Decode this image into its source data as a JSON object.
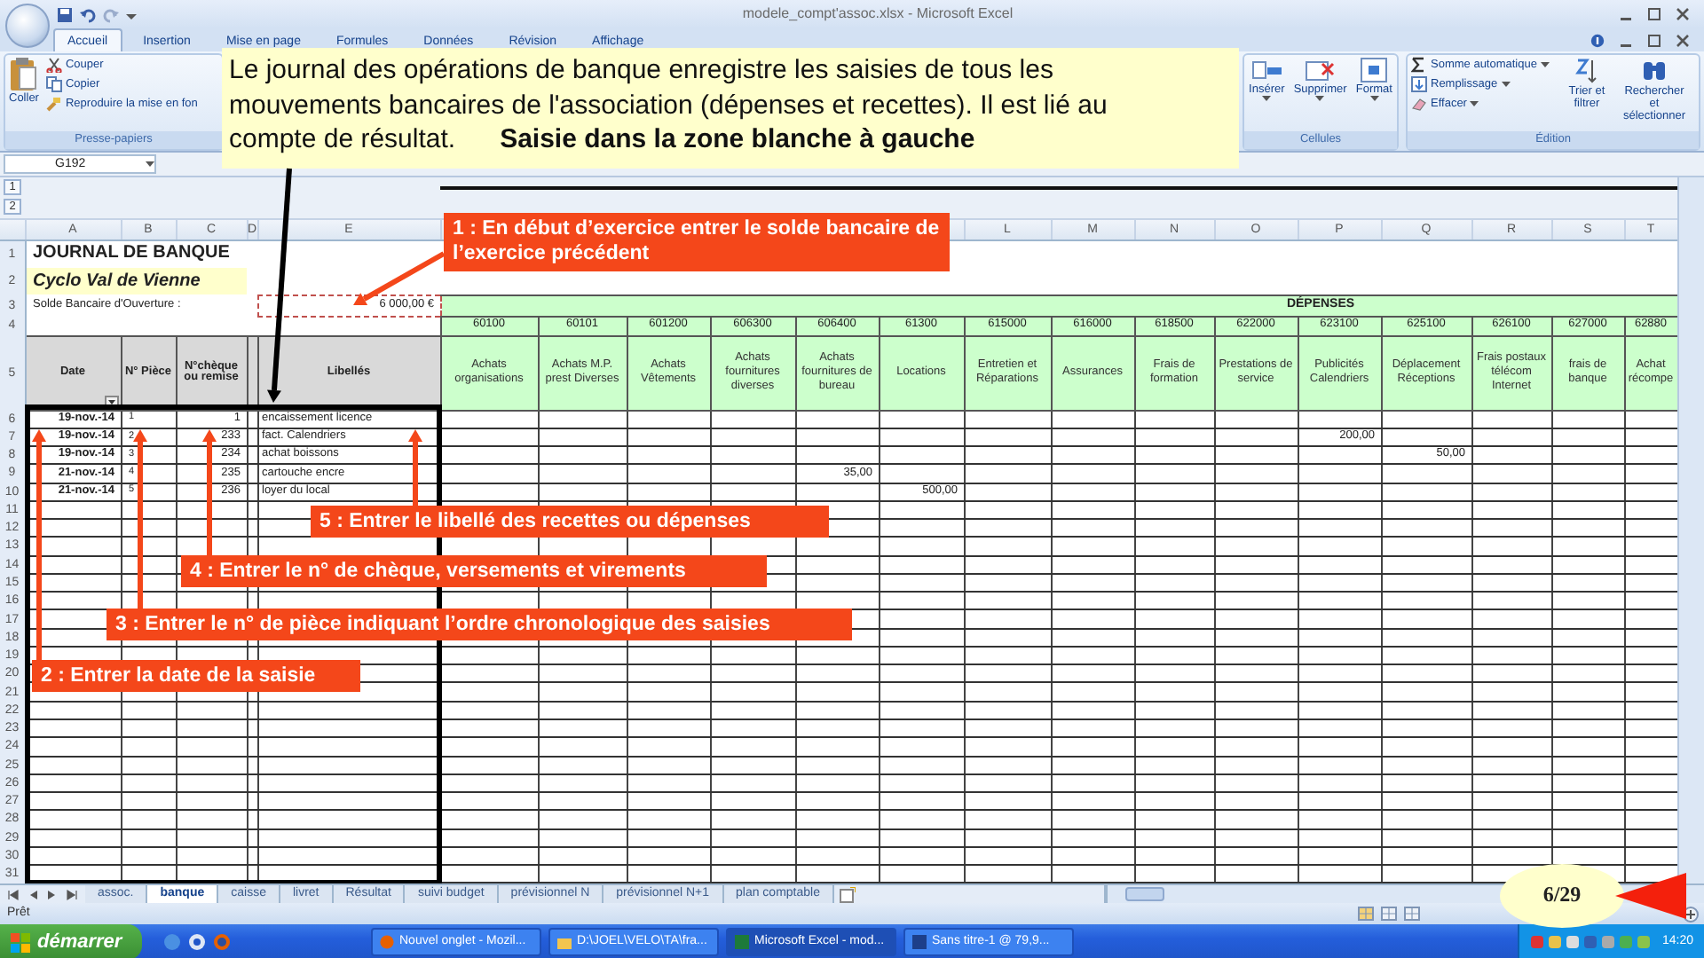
{
  "window": {
    "title": "modele_compt'assoc.xlsx - Microsoft Excel"
  },
  "ribbon": {
    "tabs": [
      {
        "label": "Accueil",
        "selected": true
      },
      {
        "label": "Insertion",
        "selected": false
      },
      {
        "label": "Mise en page",
        "selected": false
      },
      {
        "label": "Formules",
        "selected": false
      },
      {
        "label": "Données",
        "selected": false
      },
      {
        "label": "Révision",
        "selected": false
      },
      {
        "label": "Affichage",
        "selected": false
      }
    ],
    "clipboard": {
      "paste": "Coller",
      "items": [
        "Couper",
        "Copier",
        "Reproduire la mise en fon"
      ],
      "label": "Presse-papiers"
    },
    "cells": {
      "buttons": [
        "Insérer",
        "Supprimer",
        "Format"
      ],
      "label": "Cellules"
    },
    "editing": {
      "items": [
        "Somme automatique",
        "Remplissage",
        "Effacer"
      ],
      "buttons": [
        "Trier et filtrer",
        "Rechercher et sélectionner"
      ],
      "label": "Édition"
    }
  },
  "formula_bar": {
    "name_box": "G192"
  },
  "note": "Le journal des opérations de banque enregistre les saisies de tous les mouvements bancaires de l'association (dépenses et recettes). Il est lié au compte de résultat.      **Saisie dans la zone blanche à gauche**",
  "sheet": {
    "outline_buttons": [
      "1",
      "2"
    ],
    "title": "JOURNAL DE BANQUE",
    "subtitle": "Cyclo Val de Vienne",
    "opening_label": "Solde Bancaire d'Ouverture :",
    "opening_balance": "6 000,00 €",
    "section": "DÉPENSES",
    "left_columns": [
      {
        "letter": "A",
        "header": "Date",
        "filter": true
      },
      {
        "letter": "B",
        "header": "N° Pièce",
        "filter": false
      },
      {
        "letter": "C",
        "header": "N°chèque ou remise",
        "filter": false
      },
      {
        "letter": "D",
        "filter": false
      },
      {
        "letter": "E",
        "header": "Libellés",
        "filter": false
      }
    ],
    "expense_columns": [
      {
        "code": "60100",
        "name": "Achats organisations"
      },
      {
        "code": "60101",
        "name": "Achats M.P. prest Diverses"
      },
      {
        "code": "601200",
        "name": "Achats Vêtements"
      },
      {
        "code": "606300",
        "name": "Achats fournitures diverses"
      },
      {
        "code": "606400",
        "name": "Achats fournitures de bureau"
      },
      {
        "code": "61300",
        "name": "Locations"
      },
      {
        "letter": "L",
        "code": "615000",
        "name": "Entretien et Réparations"
      },
      {
        "letter": "M",
        "code": "616000",
        "name": "Assurances"
      },
      {
        "letter": "N",
        "code": "618500",
        "name": "Frais de formation"
      },
      {
        "letter": "O",
        "code": "622000",
        "name": "Prestations de service"
      },
      {
        "letter": "P",
        "code": "623100",
        "name": "Publicités Calendriers"
      },
      {
        "letter": "Q",
        "code": "625100",
        "name": "Déplacement Réceptions"
      },
      {
        "letter": "R",
        "code": "626100",
        "name": "Frais postaux télécom Internet"
      },
      {
        "letter": "S",
        "code": "627000",
        "name": "frais de banque"
      },
      {
        "letter": "T",
        "code": "62880",
        "name": "Achat récompe"
      }
    ],
    "row_numbers": [
      "1",
      "2",
      "3",
      "4",
      "5",
      "6",
      "7",
      "8",
      "9",
      "10",
      "11",
      "12",
      "13",
      "14",
      "15",
      "16",
      "17",
      "18",
      "19",
      "20",
      "21",
      "22",
      "23",
      "24",
      "25",
      "26",
      "27",
      "28",
      "29",
      "30",
      "31"
    ],
    "rows": [
      {
        "date": "19-nov.-14",
        "piece": "1",
        "cheque": "1",
        "label": "encaissement licence"
      },
      {
        "date": "19-nov.-14",
        "piece": "2",
        "cheque": "233",
        "label": "fact. Calendriers",
        "amounts": {
          "column_11": "200,00"
        }
      },
      {
        "date": "19-nov.-14",
        "piece": "3",
        "cheque": "234",
        "label": "achat boissons",
        "amounts": {
          "column_12": "50,00"
        }
      },
      {
        "date": "21-nov.-14",
        "piece": "4",
        "cheque": "235",
        "label": "cartouche encre",
        "amounts": {
          "column_5": "35,00"
        }
      },
      {
        "date": "21-nov.-14",
        "piece": "5",
        "cheque": "236",
        "label": "loyer du local",
        "amounts": {
          "column_6": "500,00"
        }
      }
    ]
  },
  "callouts": [
    "1 : En début d’exercice entrer le solde bancaire de l’exercice précédent",
    "5 : Entrer le libellé des recettes ou dépenses",
    "4 : Entrer le n° de chèque, versements et virements",
    "3 : Entrer le n° de pièce indiquant l’ordre chronologique des saisies",
    "2 : Entrer la date de la saisie"
  ],
  "sheet_tabs": [
    {
      "label": "assoc.",
      "selected": false
    },
    {
      "label": "banque",
      "selected": true
    },
    {
      "label": "caisse",
      "selected": false
    },
    {
      "label": "livret",
      "selected": false
    },
    {
      "label": "Résultat",
      "selected": false
    },
    {
      "label": "suivi budget",
      "selected": false
    },
    {
      "label": "prévisionnel N",
      "selected": false
    },
    {
      "label": "prévisionnel N+1",
      "selected": false
    },
    {
      "label": "plan comptable",
      "selected": false
    }
  ],
  "status_bar": {
    "text": "Prêt"
  },
  "slide": {
    "page": "6/29"
  },
  "taskbar": {
    "start": "démarrer",
    "tasks": [
      {
        "label": "Nouvel onglet - Mozil...",
        "selected": false
      },
      {
        "label": "D:\\JOEL\\VELO\\TA\\fra...",
        "selected": false
      },
      {
        "label": "Microsoft Excel - mod...",
        "selected": true
      },
      {
        "label": "Sans titre-1 @ 79,9...",
        "selected": false
      }
    ],
    "clock": "14:20"
  }
}
